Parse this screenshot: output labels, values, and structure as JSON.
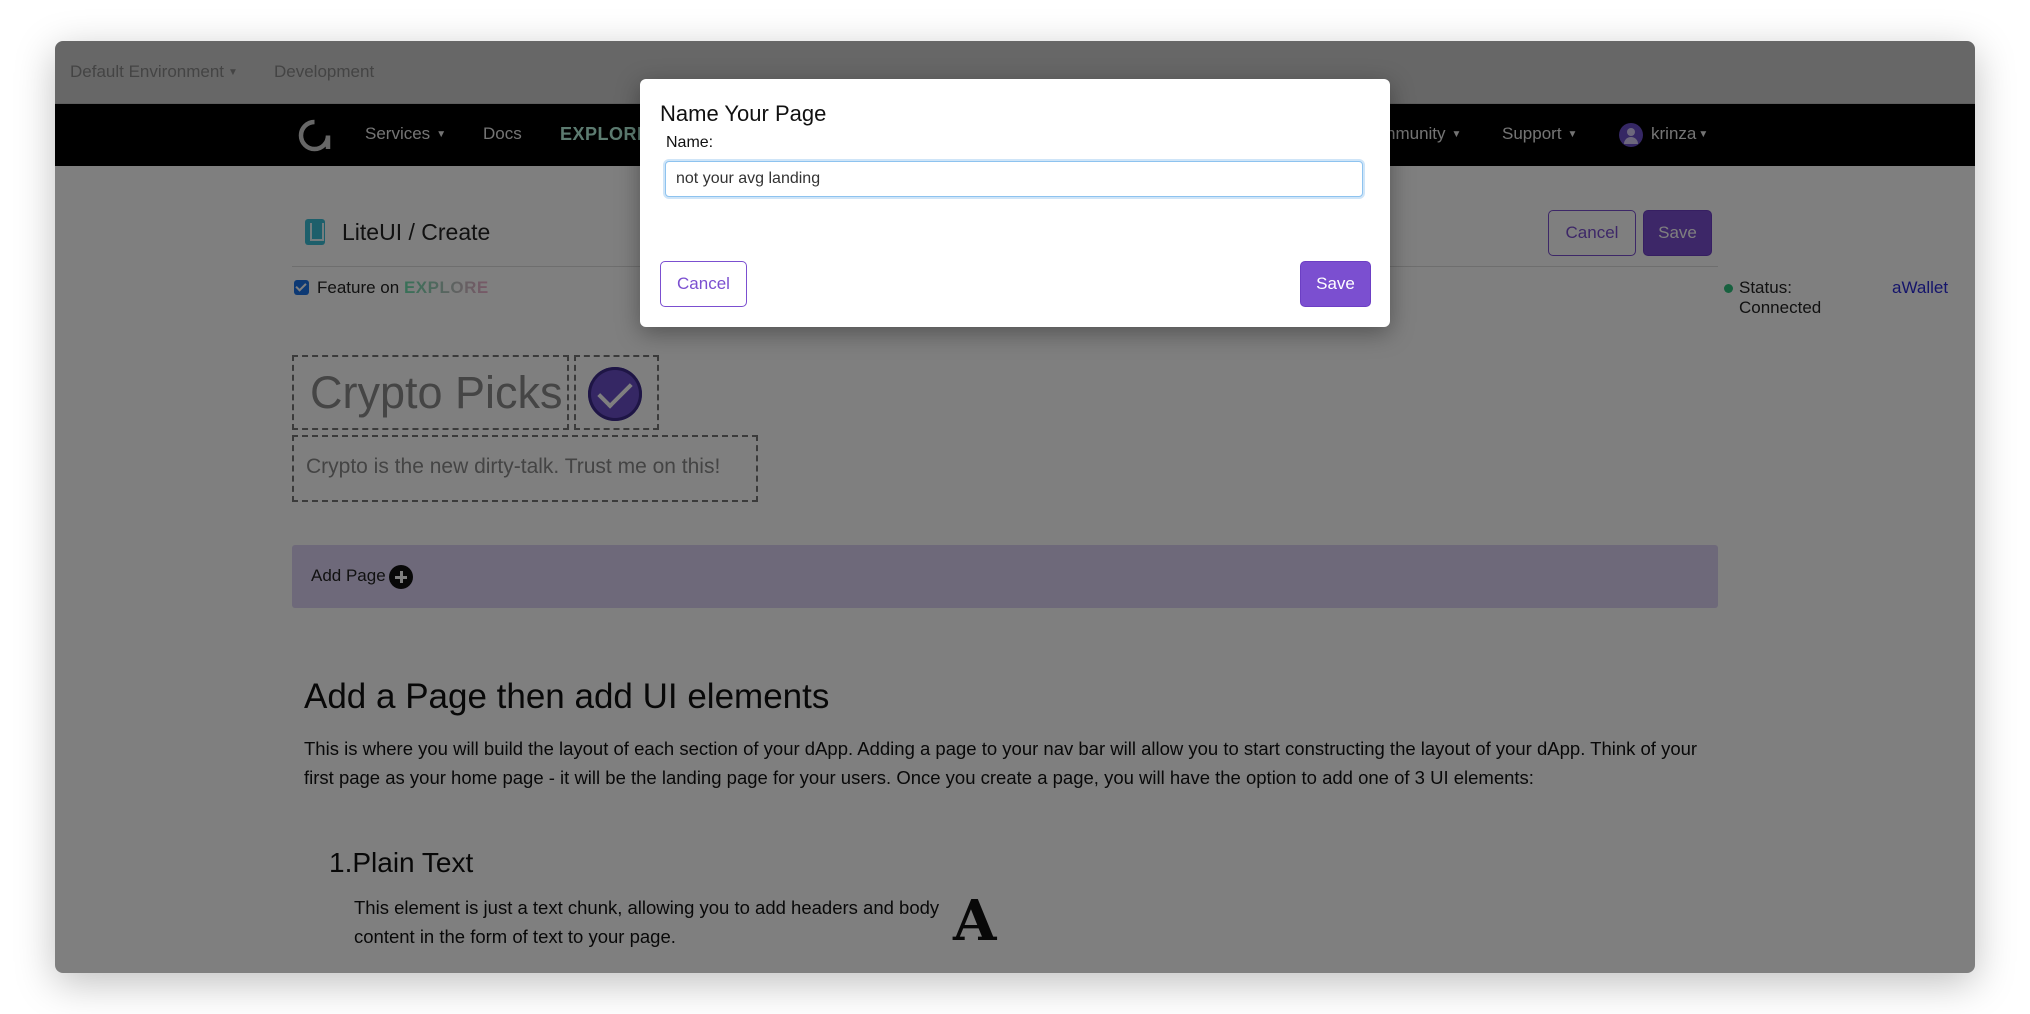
{
  "env_bar": {
    "environment": "Default Environment",
    "stage": "Development"
  },
  "nav": {
    "services": "Services",
    "docs": "Docs",
    "explore": "EXPLORE",
    "community": "nmunity",
    "support": "Support",
    "user": "krinza"
  },
  "header": {
    "title": "LiteUI / Create",
    "cancel": "Cancel",
    "save": "Save"
  },
  "feature": {
    "label": "Feature on",
    "explore": "EXPLORE",
    "status": "Status: Connected",
    "wallet": "aWallet"
  },
  "preview": {
    "title": "Crypto Picks",
    "tagline": "Crypto is the new dirty-talk. Trust me on this!"
  },
  "add_page": {
    "label": "Add Page"
  },
  "help": {
    "heading": "Add a Page then add UI elements",
    "paragraph": "This is where you will build the layout of each section of your dApp. Adding a page to your nav bar will allow you to start constructing the layout of your dApp. Think of your first page as your home page - it will be the landing page for your users. Once you create a page, you will have the option to add one of 3 UI elements:",
    "item1_title": "1.Plain Text",
    "item1_text": "This element is just a text chunk, allowing you to add headers and body content in the form of text to your page.",
    "item1_glyph": "A"
  },
  "modal": {
    "title": "Name Your Page",
    "name_label": "Name:",
    "name_value": "not your avg landing",
    "cancel": "Cancel",
    "save": "Save"
  },
  "colors": {
    "accent": "#7b4fd0",
    "nav_bg": "#000000",
    "add_page_bg": "#dcd3f4",
    "status": "#2ec27e"
  },
  "icons": [
    "logo-icon",
    "chevron-down-icon",
    "user-avatar-icon",
    "page-icon",
    "checkbox-icon",
    "status-dot-icon",
    "verified-check-icon",
    "plus-circle-icon"
  ]
}
